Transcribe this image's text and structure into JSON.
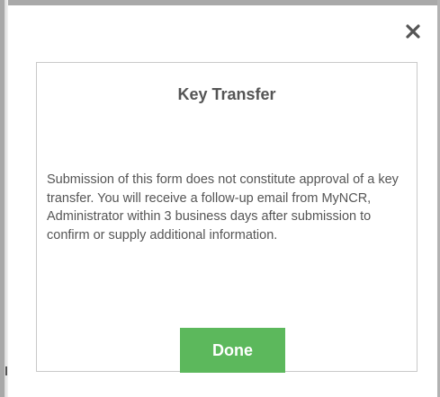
{
  "dialog": {
    "close_icon": "close-icon",
    "title": "Key Transfer",
    "message": "Submission of this form does not constitute approval of a key transfer. You will receive a follow-up email from MyNCR, Administrator within 3 business days after submission to confirm or supply additional information.",
    "done_label": "Done"
  },
  "colors": {
    "done_button": "#5cb85c",
    "text": "#555555",
    "panel_border": "#c9c9c9"
  }
}
